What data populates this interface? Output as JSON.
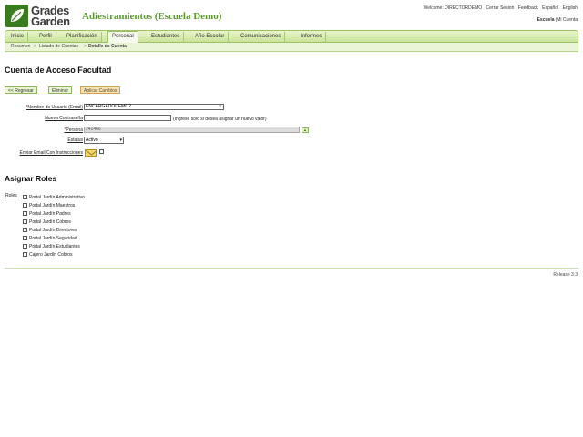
{
  "brand": {
    "logo_line1": "Grades",
    "logo_line2": "Garden",
    "app_title": "Adiestramientos (Escuela Demo)"
  },
  "topnav": {
    "welcome": "Welcome: DIRECTORDEMO",
    "logout": "Cerrar Sesion",
    "feedback": "Feedback",
    "lang_es": "Español",
    "lang_en": "English"
  },
  "school": {
    "label": "Escuela",
    "separator": "|",
    "my_account": "Mi Cuenta"
  },
  "tabs": [
    {
      "label": "Inicio"
    },
    {
      "label": "Perfil"
    },
    {
      "label": "Planificación"
    },
    {
      "label": "Personal"
    },
    {
      "label": "Estudiantes"
    },
    {
      "label": "Año Escolar"
    },
    {
      "label": "Comunicaciones"
    },
    {
      "label": "Informes"
    }
  ],
  "breadcrumb": {
    "items": [
      "Resumen",
      "Listado de Cuentas",
      "Detalle de Cuenta"
    ],
    "separator": ">"
  },
  "page_title": "Cuenta de Acceso Facultad",
  "buttons": {
    "back": "<< Regresar",
    "delete": "Eliminar",
    "apply": "Aplicar Cambios"
  },
  "form": {
    "username_label": "Nombre de Usuario (Email)",
    "username_value": "ENCARGADODEMO2",
    "clear_glyph": "×",
    "password_label": "Nueva Contraseña",
    "password_value": "",
    "password_hint": "(Ingrese sólo si desea asignar un nuevo valor)",
    "person_label": "Persona",
    "person_value": "241466",
    "lookup_glyph": "▲",
    "status_label": "Estatus",
    "status_value": "Activo",
    "email_label": "Enviar Email Con Instrucciones",
    "required_mark": "*"
  },
  "roles_section": {
    "title": "Asignar Roles",
    "label": "Roles",
    "items": [
      "Portal Jardín Administrativo",
      "Portal Jardín Maestros",
      "Portal Jardín Padres",
      "Portal Jardín Cobros",
      "Portal Jardín Directores",
      "Portal Jardín Seguridad",
      "Portal Jardín Estudiantes",
      "Cajero Jardín Cobros"
    ]
  },
  "footer": {
    "release": "Release 3.3"
  },
  "colors": {
    "accent_green": "#5a9a2c",
    "tab_bg": "#c9e39a",
    "warn_button": "#f7e2b8"
  }
}
